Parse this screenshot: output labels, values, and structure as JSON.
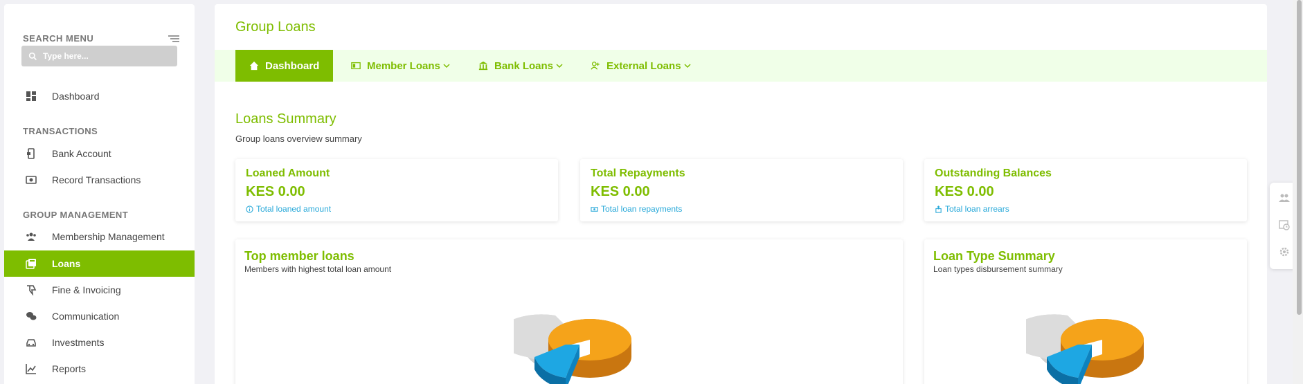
{
  "sidebar": {
    "search_title": "SEARCH MENU",
    "search_placeholder": "Type here...",
    "items": [
      {
        "label": "Dashboard"
      },
      {
        "label": "Bank Account"
      },
      {
        "label": "Record Transactions"
      },
      {
        "label": "Membership Management"
      },
      {
        "label": "Loans"
      },
      {
        "label": "Fine & Invoicing"
      },
      {
        "label": "Communication"
      },
      {
        "label": "Investments"
      },
      {
        "label": "Reports"
      }
    ],
    "sections": {
      "transactions": "TRANSACTIONS",
      "group_management": "GROUP MANAGEMENT"
    },
    "active_item": "Loans",
    "accent_color": "#7ebd00"
  },
  "header": {
    "title": "Group Loans"
  },
  "nav": {
    "tabs": [
      {
        "label": "Dashboard",
        "icon": "home-icon"
      },
      {
        "label": "Member Loans",
        "icon": "id-card-icon"
      },
      {
        "label": "Bank Loans",
        "icon": "bank-icon"
      },
      {
        "label": "External Loans",
        "icon": "user-plus-icon"
      }
    ],
    "active_tab": "Dashboard"
  },
  "summary": {
    "title": "Loans Summary",
    "subtitle": "Group loans overview summary",
    "cards": [
      {
        "label": "Loaned Amount",
        "value": "KES 0.00",
        "note": "Total loaned amount",
        "icon": "info-circle-icon"
      },
      {
        "label": "Total Repayments",
        "value": "KES 0.00",
        "note": "Total loan repayments",
        "icon": "cash-icon"
      },
      {
        "label": "Outstanding Balances",
        "value": "KES 0.00",
        "note": "Total loan arrears",
        "icon": "box-icon"
      }
    ]
  },
  "panels": [
    {
      "title": "Top member loans",
      "subtitle": "Members with highest total loan amount"
    },
    {
      "title": "Loan Type Summary",
      "subtitle": "Loan types disbursement summary"
    }
  ],
  "float_bar": {
    "icons": [
      "users-icon",
      "calendar-clock-icon",
      "gear-icon"
    ]
  },
  "colors": {
    "accent": "#7ebd00",
    "link": "#29a9d9",
    "pie_orange": "#f5a31a",
    "pie_blue": "#1ea7e3",
    "pie_gray": "#cfcfcf"
  }
}
